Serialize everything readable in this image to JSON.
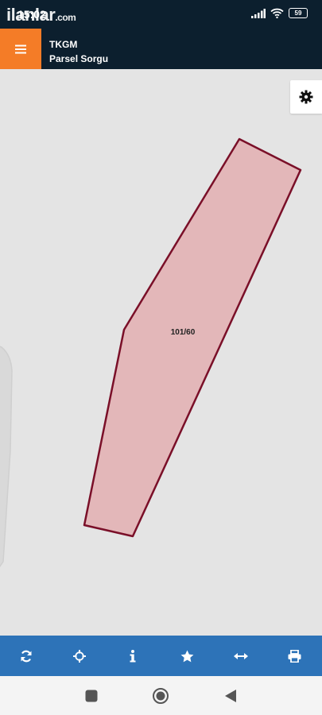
{
  "status_bar": {
    "time": "15:02",
    "watermark_main": "ilanlar",
    "watermark_domain": ".com",
    "battery": "59"
  },
  "app_bar": {
    "title": "TKGM",
    "subtitle": "Parsel Sorgu"
  },
  "map": {
    "parcel_label": "101/60",
    "parcel_fill": "#e3b7b9",
    "parcel_stroke": "#7a0f28"
  },
  "colors": {
    "accent": "#f47c27",
    "header": "#0c1f2e",
    "toolbar": "#2d73b8"
  },
  "toolbar": {
    "items": [
      "refresh-icon",
      "locate-icon",
      "info-icon",
      "star-icon",
      "measure-icon",
      "print-icon"
    ]
  },
  "nav": {
    "items": [
      "recents-icon",
      "home-icon",
      "back-icon"
    ]
  }
}
